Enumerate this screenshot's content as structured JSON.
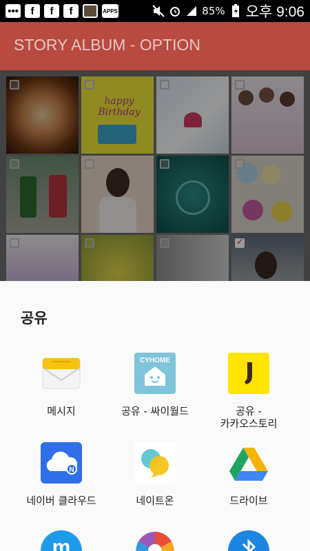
{
  "status_bar": {
    "left_icons": [
      "chat-icon",
      "facebook-icon",
      "facebook-icon",
      "facebook-icon",
      "camera-app-icon",
      "apps-icon"
    ],
    "apps_label": "APPS",
    "battery_percent": "85%",
    "time": "오후 9:06"
  },
  "app_bar": {
    "title": "STORY ALBUM - OPTION",
    "color": "#b84a40"
  },
  "grid": {
    "tiles": [
      {
        "desc": "latte-art",
        "checked": false
      },
      {
        "desc": "happy-birthday-card",
        "checked": false
      },
      {
        "desc": "heart-drawing",
        "checked": false
      },
      {
        "desc": "group-photo",
        "checked": false
      },
      {
        "desc": "kids-taekwondo",
        "checked": false
      },
      {
        "desc": "woman-portrait",
        "checked": false
      },
      {
        "desc": "green-cup",
        "checked": false
      },
      {
        "desc": "flower-cookies",
        "checked": false
      },
      {
        "desc": "flowers-close-up",
        "checked": false
      },
      {
        "desc": "flower-cookie-plates",
        "checked": false
      },
      {
        "desc": "collage",
        "checked": false
      },
      {
        "desc": "man-portrait",
        "checked": true
      }
    ],
    "birthday_text": "happy Birthday"
  },
  "share": {
    "title": "공유",
    "apps": [
      {
        "label": "메시지",
        "icon": "message-icon"
      },
      {
        "label": "공유 - 싸이월드",
        "icon": "cyworld-icon",
        "brand": "CYHOME"
      },
      {
        "label_lines": [
          "공유 -",
          "카카오스토리"
        ],
        "icon": "kakaostory-icon"
      },
      {
        "label": "네이버 클라우드",
        "icon": "naver-cloud-icon"
      },
      {
        "label": "네이트온",
        "icon": "nateon-icon"
      },
      {
        "label": "드라이브",
        "icon": "google-drive-icon"
      },
      {
        "label": "",
        "icon": "naver-band-icon"
      },
      {
        "label": "",
        "icon": "photo-icon"
      },
      {
        "label": "",
        "icon": "bluetooth-icon"
      }
    ]
  }
}
